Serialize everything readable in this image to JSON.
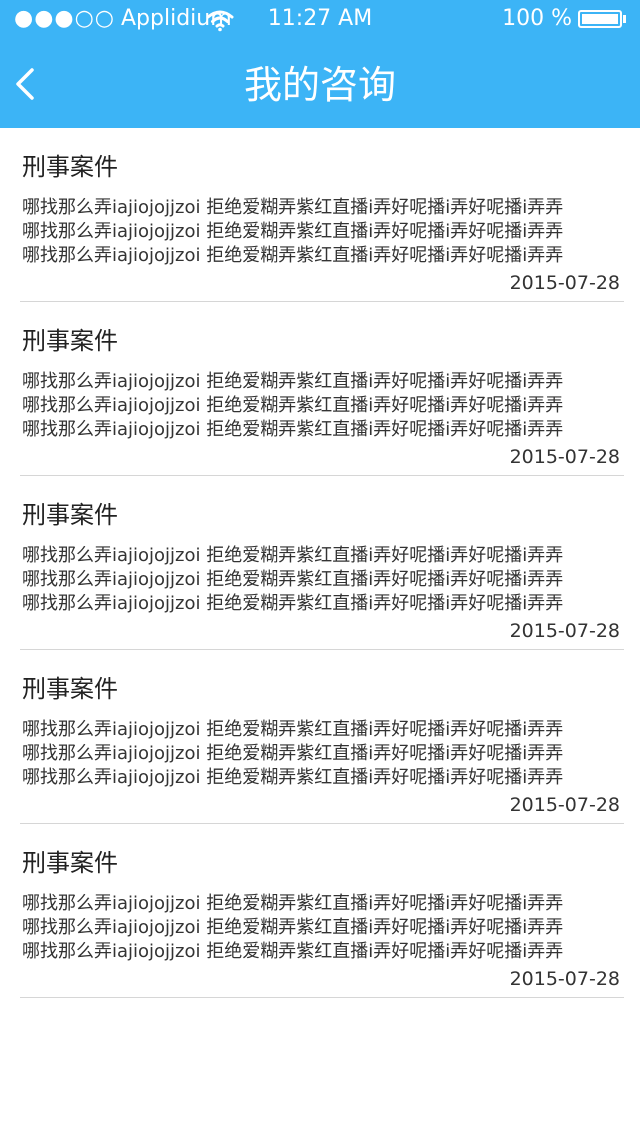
{
  "colors": {
    "accent": "#3cb4f6"
  },
  "status_bar": {
    "signal": "●●●○○",
    "carrier": "Applidium",
    "time": "11:27 AM",
    "battery_text": "100 %",
    "battery_level": 1.0
  },
  "nav": {
    "back_icon": "chevron-left-icon",
    "title": "我的咨询"
  },
  "items": [
    {
      "title": "刑事案件",
      "lines": [
        "哪找那么弄iajiojojjzoi 拒绝爱糊弄紫红直播i弄好呢播i弄好呢播i弄弄",
        "哪找那么弄iajiojojjzoi 拒绝爱糊弄紫红直播i弄好呢播i弄好呢播i弄弄",
        "哪找那么弄iajiojojjzoi 拒绝爱糊弄紫红直播i弄好呢播i弄好呢播i弄弄"
      ],
      "date": "2015-07-28"
    },
    {
      "title": "刑事案件",
      "lines": [
        "哪找那么弄iajiojojjzoi 拒绝爱糊弄紫红直播i弄好呢播i弄好呢播i弄弄",
        "哪找那么弄iajiojojjzoi 拒绝爱糊弄紫红直播i弄好呢播i弄好呢播i弄弄",
        "哪找那么弄iajiojojjzoi 拒绝爱糊弄紫红直播i弄好呢播i弄好呢播i弄弄"
      ],
      "date": "2015-07-28"
    },
    {
      "title": "刑事案件",
      "lines": [
        "哪找那么弄iajiojojjzoi 拒绝爱糊弄紫红直播i弄好呢播i弄好呢播i弄弄",
        "哪找那么弄iajiojojjzoi 拒绝爱糊弄紫红直播i弄好呢播i弄好呢播i弄弄",
        "哪找那么弄iajiojojjzoi 拒绝爱糊弄紫红直播i弄好呢播i弄好呢播i弄弄"
      ],
      "date": "2015-07-28"
    },
    {
      "title": "刑事案件",
      "lines": [
        "哪找那么弄iajiojojjzoi 拒绝爱糊弄紫红直播i弄好呢播i弄好呢播i弄弄",
        "哪找那么弄iajiojojjzoi 拒绝爱糊弄紫红直播i弄好呢播i弄好呢播i弄弄",
        "哪找那么弄iajiojojjzoi 拒绝爱糊弄紫红直播i弄好呢播i弄好呢播i弄弄"
      ],
      "date": "2015-07-28"
    },
    {
      "title": "刑事案件",
      "lines": [
        "哪找那么弄iajiojojjzoi 拒绝爱糊弄紫红直播i弄好呢播i弄好呢播i弄弄",
        "哪找那么弄iajiojojjzoi 拒绝爱糊弄紫红直播i弄好呢播i弄好呢播i弄弄",
        "哪找那么弄iajiojojjzoi 拒绝爱糊弄紫红直播i弄好呢播i弄好呢播i弄弄"
      ],
      "date": "2015-07-28"
    }
  ]
}
